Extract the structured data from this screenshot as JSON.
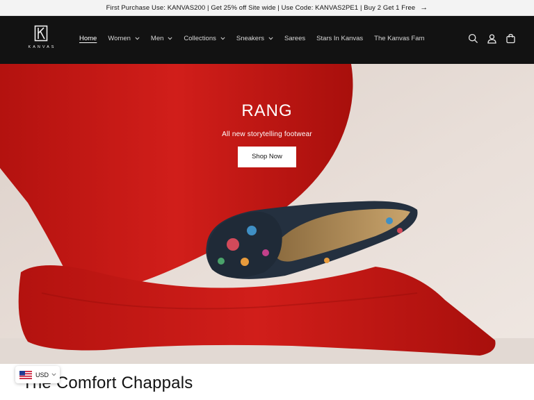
{
  "announcement": {
    "text": "First Purchase Use: KANVAS200 | Get 25% off Site wide | Use Code: KANVAS2PE1 | Buy 2 Get 1 Free",
    "arrow_icon": "arrow-right-icon"
  },
  "header": {
    "logo_text": "KANVAS",
    "nav": [
      {
        "label": "Home",
        "active": true,
        "dropdown": false
      },
      {
        "label": "Women",
        "dropdown": true
      },
      {
        "label": "Men",
        "dropdown": true
      },
      {
        "label": "Collections",
        "dropdown": true
      },
      {
        "label": "Sneakers",
        "dropdown": true
      },
      {
        "label": "Sarees",
        "dropdown": false
      },
      {
        "label": "Stars In Kanvas",
        "dropdown": false
      },
      {
        "label": "The Kanvas Fam",
        "dropdown": false
      }
    ],
    "icons": [
      "search-icon",
      "account-icon",
      "cart-icon"
    ]
  },
  "hero": {
    "title": "RANG",
    "subtitle": "All new storytelling footwear",
    "button_label": "Shop Now"
  },
  "section": {
    "title": "The Comfort Chappals"
  },
  "currency": {
    "code": "USD",
    "flag_icon": "us-flag-icon"
  },
  "colors": {
    "header_bg": "#121212",
    "announcement_bg": "#f3f3f3",
    "hero_red": "#c41a17",
    "hero_bg": "#e6dcd6"
  }
}
